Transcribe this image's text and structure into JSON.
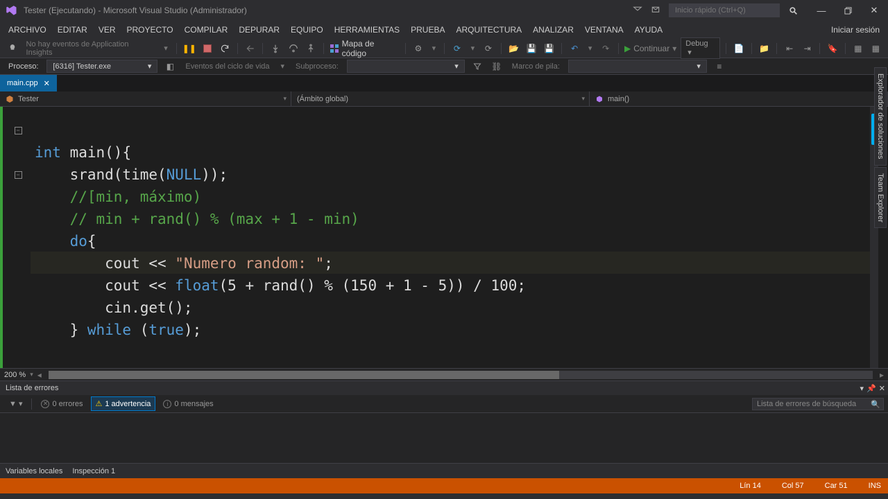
{
  "title": "Tester (Ejecutando) - Microsoft Visual Studio (Administrador)",
  "quick_launch_placeholder": "Inicio rápido (Ctrl+Q)",
  "signin": "Iniciar sesión",
  "menu": [
    "ARCHIVO",
    "EDITAR",
    "VER",
    "PROYECTO",
    "COMPILAR",
    "DEPURAR",
    "EQUIPO",
    "HERRAMIENTAS",
    "PRUEBA",
    "ARQUITECTURA",
    "ANALIZAR",
    "VENTANA",
    "AYUDA"
  ],
  "toolbar": {
    "insights": "No hay eventos de Application Insights",
    "codemap": "Mapa de código",
    "continue": "Continuar",
    "config": "Debug"
  },
  "process": {
    "label": "Proceso:",
    "value": "[6316] Tester.exe",
    "lifecycle": "Eventos del ciclo de vida",
    "thread_label": "Subproceso:",
    "frame_label": "Marco de pila:"
  },
  "tab": {
    "name": "main.cpp"
  },
  "navs": {
    "class": "Tester",
    "scope": "(Ámbito global)",
    "member": "main()"
  },
  "code": {
    "l1a": "int",
    "l1b": " main(){",
    "l2": "    srand(time(",
    "l2null": "NULL",
    "l2b": "));",
    "l3": "    //[min, máximo)",
    "l4": "    // min + rand() % (max + 1 - min)",
    "l5a": "    ",
    "l5do": "do",
    "l5b": "{",
    "l6a": "        cout << ",
    "l6s": "\"Numero random: \"",
    "l6b": ";",
    "l7a": "        cout << ",
    "l7f": "float",
    "l7b": "(5 + rand() % (150 + 1 - 5)) / 100;",
    "l8": "        cin.get();",
    "l9a": "    } ",
    "l9w": "while",
    "l9b": " (",
    "l9t": "true",
    "l9c": ");"
  },
  "zoom": "200 %",
  "errorlist": {
    "title": "Lista de errores",
    "errors": "0 errores",
    "warnings": "1 advertencia",
    "messages": "0 mensajes",
    "search_placeholder": "Lista de errores de búsqueda"
  },
  "bottom_tabs": [
    "Variables locales",
    "Inspección 1"
  ],
  "right_tabs": [
    "Explorador de soluciones",
    "Team Explorer"
  ],
  "status": {
    "ln": "Lín 14",
    "col": "Col 57",
    "car": "Car 51",
    "ins": "INS"
  }
}
